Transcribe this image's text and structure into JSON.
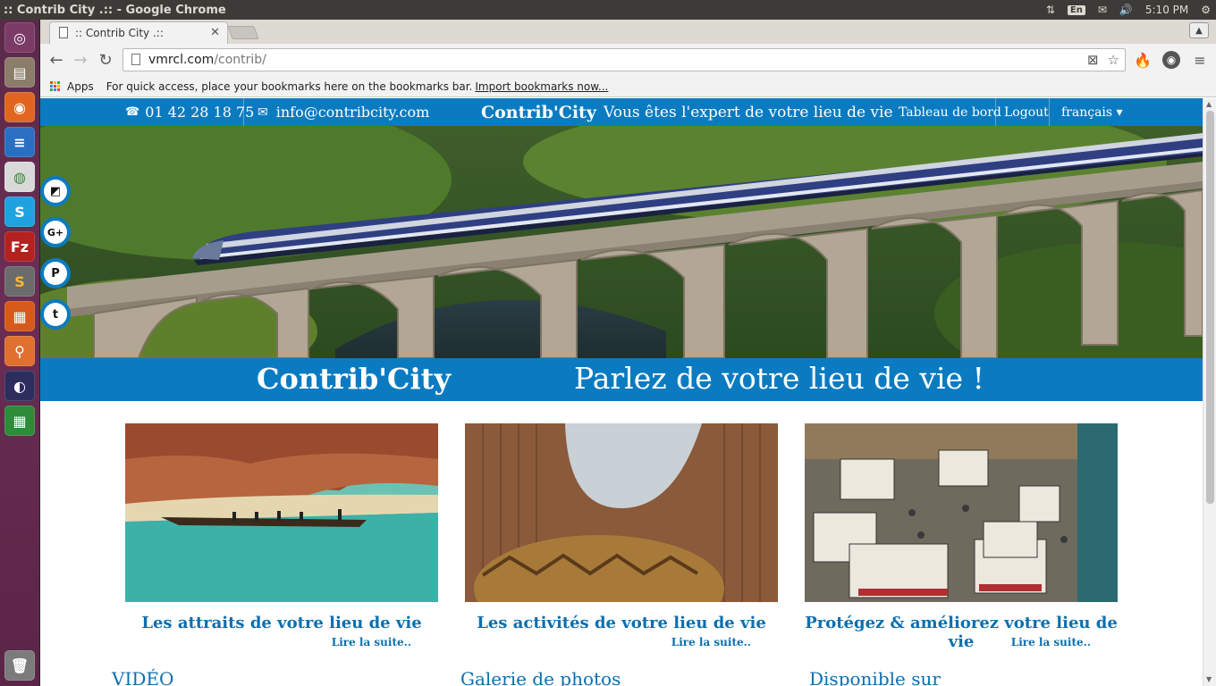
{
  "os": {
    "window_title": ":: Contrib City .:: - Google Chrome",
    "keyboard_layout": "En",
    "clock": "5:10 PM"
  },
  "browser": {
    "tab_title": ":: Contrib City .::",
    "url_host": "vmrcl.com",
    "url_path": "/contrib/",
    "bookmarks": {
      "apps_label": "Apps",
      "hint": "For quick access, place your bookmarks here on the bookmarks bar.",
      "import_link": "Import bookmarks now..."
    }
  },
  "site": {
    "nav": {
      "phone": "01 42 28 18 75",
      "email": "info@contribcity.com",
      "brand": "Contrib'City",
      "tagline": "Vous êtes l'expert de votre lieu de vie",
      "dashboard": "Tableau de bord",
      "logout": "Logout",
      "language": "français ▾"
    },
    "social": [
      {
        "icon": "delicious-icon",
        "glyph": "◩"
      },
      {
        "icon": "google-plus-icon",
        "glyph": "G+"
      },
      {
        "icon": "pinterest-icon",
        "glyph": "P"
      },
      {
        "icon": "tumblr-icon",
        "glyph": "t"
      }
    ],
    "banner": {
      "title": "Contrib'City",
      "subtitle": "Parlez de votre lieu de vie !"
    },
    "cards": [
      {
        "title": "Les attraits de votre lieu de vie",
        "more": "Lire la suite.."
      },
      {
        "title": "Les activités de votre lieu de vie",
        "more": "Lire la suite.."
      },
      {
        "title": "Protégez & améliorez votre lieu de vie",
        "more": "Lire la suite.."
      }
    ],
    "sections": {
      "video": "VIDÉO",
      "gallery": "Galerie de photos",
      "available": "Disponible sur"
    }
  },
  "colors": {
    "brand_blue": "#0b7bc1",
    "link_blue": "#0b6fb0"
  }
}
